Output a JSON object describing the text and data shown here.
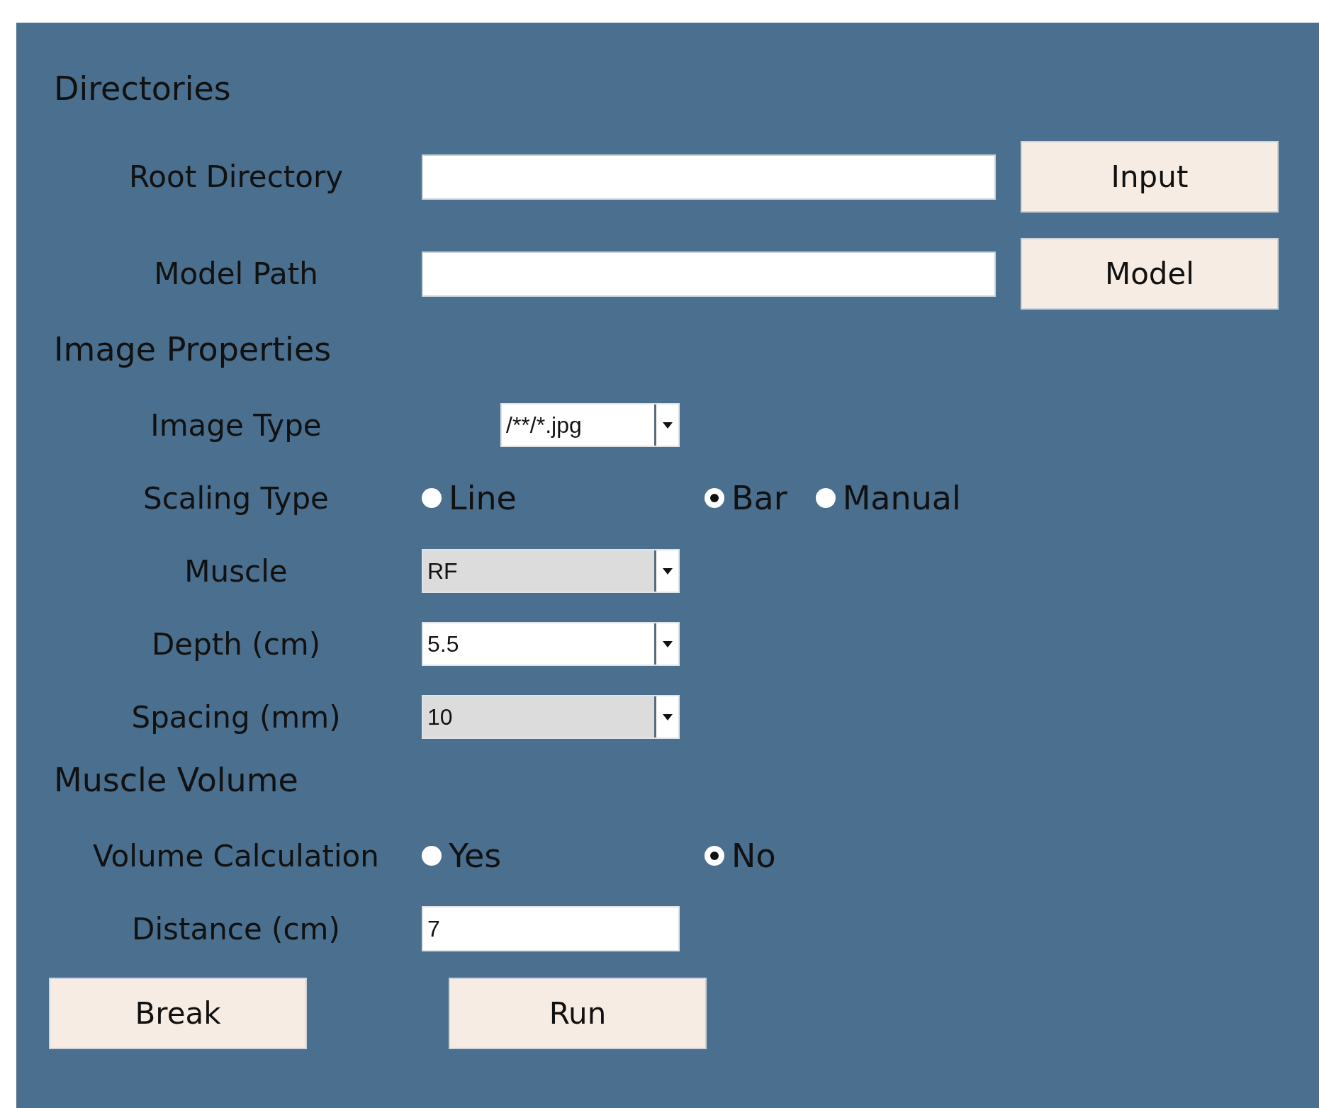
{
  "sections": [
    {
      "heading": "Directories",
      "rows": [
        {
          "kind": "path",
          "label": "Root Directory",
          "button": "Input"
        },
        {
          "kind": "path",
          "label": "Model Path",
          "button": "Model"
        }
      ]
    },
    {
      "heading": "Image Properties",
      "rows": [
        {
          "kind": "pattern-combo",
          "label": "Image Type",
          "value": "/**/*.jpg",
          "disabled": false
        },
        {
          "kind": "radio",
          "label": "Scaling Type",
          "options": [
            {
              "label": "Line",
              "selected": false
            },
            {
              "label": "Bar",
              "selected": true
            },
            {
              "label": "Manual",
              "selected": false
            }
          ]
        },
        {
          "kind": "combo",
          "label": "Muscle",
          "value": "RF",
          "disabled": true
        },
        {
          "kind": "combo",
          "label": "Depth (cm)",
          "value": "5.5",
          "disabled": false
        },
        {
          "kind": "combo",
          "label": "Spacing (mm)",
          "value": "10",
          "disabled": true
        }
      ]
    },
    {
      "heading": "Muscle Volume",
      "rows": [
        {
          "kind": "radio",
          "label": "Volume Calculation",
          "options": [
            {
              "label": "Yes",
              "selected": false
            },
            {
              "label": "No",
              "selected": true
            }
          ]
        },
        {
          "kind": "text",
          "label": "Distance (cm)",
          "value": "7"
        }
      ]
    }
  ],
  "footer_buttons": [
    "Break",
    "Run"
  ]
}
